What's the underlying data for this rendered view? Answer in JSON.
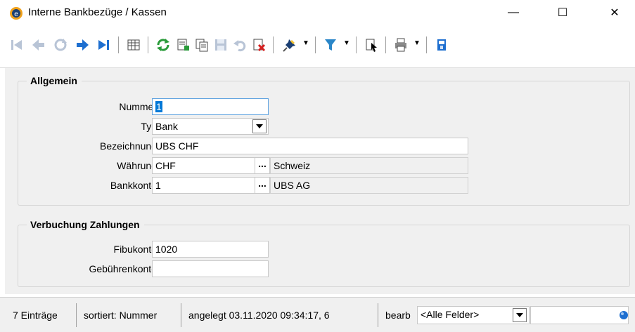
{
  "window": {
    "title": "Interne Bankbezüge / Kassen",
    "minimize_label": "—",
    "maximize_label": "☐",
    "close_label": "✕"
  },
  "toolbar": {
    "icons": [
      "first-record-icon",
      "previous-record-icon",
      "refresh-disabled-icon",
      "next-record-icon",
      "last-record-icon",
      "table-view-icon",
      "reload-icon",
      "new-record-icon",
      "copy-record-icon",
      "save-icon",
      "undo-icon",
      "delete-icon",
      "pin-icon",
      "filter-icon",
      "lookup-icon",
      "print-icon",
      "exit-icon"
    ]
  },
  "allgemein": {
    "title": "Allgemein",
    "nummer_label": "Nummer",
    "nummer_value": "1",
    "typ_label": "Typ",
    "typ_value": "Bank",
    "bezeichnung_label": "Bezeichnung",
    "bezeichnung_value": "UBS CHF",
    "waehrung_label": "Währung",
    "waehrung_value": "CHF",
    "waehrung_lookup_label": "...",
    "waehrung_desc": "Schweiz",
    "bankkonto_label": "Bankkonto",
    "bankkonto_value": "1",
    "bankkonto_lookup_label": "...",
    "bankkonto_desc": "UBS AG"
  },
  "verbuchung": {
    "title": "Verbuchung Zahlungen",
    "fibukonto_label": "Fibukonto",
    "fibukonto_value": "1020",
    "gebuehren_label": "Gebührenkonto",
    "gebuehren_value": ""
  },
  "statusbar": {
    "count": "7 Einträge",
    "sort": "sortiert: Nummer",
    "created": "angelegt 03.11.2020 09:34:17, 6",
    "edited": "bearb",
    "field_filter": "<Alle Felder>",
    "search_value": ""
  },
  "colors": {
    "arrow_blue": "#1e6fd0",
    "disabled_gray": "#b8c4d6",
    "green": "#2a9b3a",
    "red": "#d42020",
    "focus_border": "#5ea2e0"
  }
}
